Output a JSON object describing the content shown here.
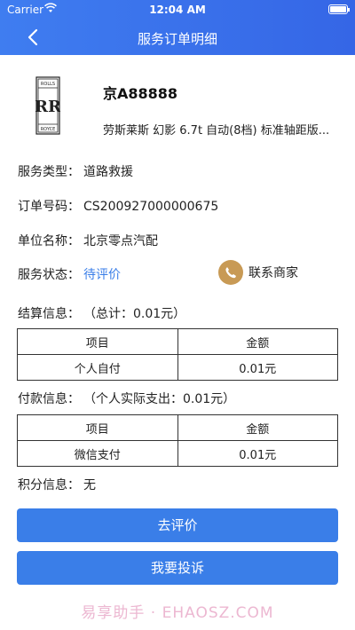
{
  "status_bar": {
    "carrier": "Carrier",
    "time": "12:04 AM"
  },
  "nav": {
    "title": "服务订单明细"
  },
  "car": {
    "logo_top": "ROLLS",
    "logo_mid": "RR",
    "logo_bottom": "ROYCE",
    "plate": "京A88888",
    "model": "劳斯莱斯 幻影 6.7t 自动(8档) 标准轴距版..."
  },
  "info": {
    "service_type_label": "服务类型：",
    "service_type_value": "道路救援",
    "order_no_label": "订单号码：",
    "order_no_value": "CS200927000000675",
    "unit_label": "单位名称：",
    "unit_value": "北京零点汽配",
    "status_label": "服务状态：",
    "status_value": "待评价",
    "contact_label": "联系商家"
  },
  "settlement": {
    "title": "结算信息：",
    "total": "（总计：0.01元）",
    "headers": [
      "项目",
      "金额"
    ],
    "rows": [
      [
        "个人自付",
        "0.01元"
      ]
    ]
  },
  "payment": {
    "title": "付款信息：",
    "total": "（个人实际支出：0.01元）",
    "headers": [
      "项目",
      "金额"
    ],
    "rows": [
      [
        "微信支付",
        "0.01元"
      ]
    ]
  },
  "points": {
    "label": "积分信息：",
    "value": "无"
  },
  "buttons": {
    "review": "去评价",
    "complaint": "我要投诉"
  },
  "watermark": "易享助手 · EHAOSZ.COM",
  "colors": {
    "accent": "#3a7ee8",
    "header": "#3566e6",
    "contact_icon": "#c89a55"
  }
}
